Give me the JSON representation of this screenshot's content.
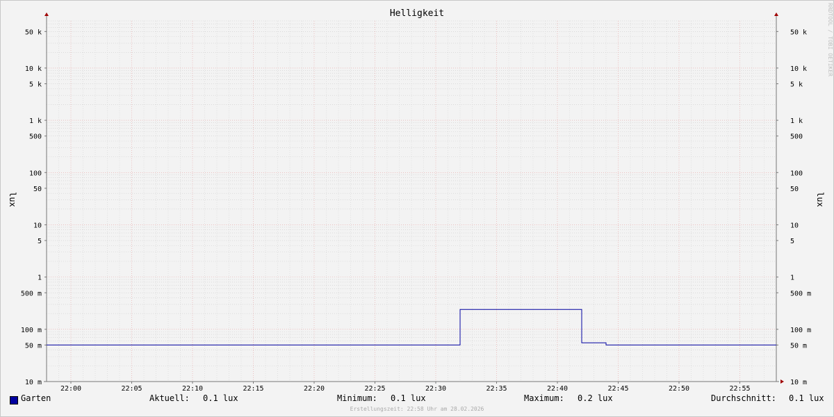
{
  "watermark": "RRDTOOL / TOBI OETIKER",
  "chart_data": {
    "type": "line",
    "title": "Helligkeit",
    "ylabel": "lux",
    "yscale": "log",
    "ylim": [
      0.01,
      80000
    ],
    "xlim": [
      "21:58",
      "21:58:00"
    ],
    "x_range": [
      "21:58",
      "22:58"
    ],
    "x_ticks": [
      "22:00",
      "22:05",
      "22:10",
      "22:15",
      "22:20",
      "22:25",
      "22:30",
      "22:35",
      "22:40",
      "22:45",
      "22:50",
      "22:55"
    ],
    "y_ticks": [
      {
        "value": 50000,
        "label": "50 k"
      },
      {
        "value": 10000,
        "label": "10 k"
      },
      {
        "value": 5000,
        "label": "5 k"
      },
      {
        "value": 1000,
        "label": "1 k"
      },
      {
        "value": 500,
        "label": "500"
      },
      {
        "value": 100,
        "label": "100"
      },
      {
        "value": 50,
        "label": "50"
      },
      {
        "value": 10,
        "label": "10"
      },
      {
        "value": 5,
        "label": "5"
      },
      {
        "value": 1,
        "label": "1"
      },
      {
        "value": 0.5,
        "label": "500 m"
      },
      {
        "value": 0.1,
        "label": "100 m"
      },
      {
        "value": 0.05,
        "label": "50 m"
      },
      {
        "value": 0.01,
        "label": "10 m"
      }
    ],
    "grid": true,
    "series": [
      {
        "name": "Garten",
        "color": "#0000a0",
        "x": [
          "21:58",
          "22:32",
          "22:32",
          "22:42",
          "22:42",
          "22:44",
          "22:44",
          "22:58"
        ],
        "y": [
          0.05,
          0.05,
          0.24,
          0.24,
          0.055,
          0.055,
          0.05,
          0.05
        ]
      }
    ]
  },
  "legend": {
    "series_name": "Garten",
    "current_label": "Aktuell:",
    "current_value": "0.1 lux",
    "min_label": "Minimum:",
    "min_value": "0.1 lux",
    "max_label": "Maximum:",
    "max_value": "0.2 lux",
    "avg_label": "Durchschnitt:",
    "avg_value": "0.1 lux"
  },
  "footer": "Erstellungszeit: 22:58 Uhr am 28.02.2026"
}
